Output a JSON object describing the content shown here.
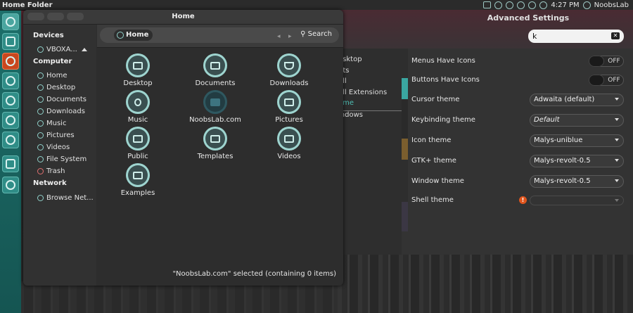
{
  "panel": {
    "title": "Home Folder",
    "time": "4:27 PM",
    "user": "NoobsLab"
  },
  "launcher": {
    "icons": [
      "ubuntu-icon",
      "files-icon",
      "firefox-icon",
      "app-icon",
      "app-icon",
      "app-icon",
      "app-icon",
      "app-icon",
      "app-icon"
    ]
  },
  "advanced": {
    "title": "Advanced Settings",
    "search_value": "k",
    "categories": [
      "Desktop",
      "Fonts",
      "Shell",
      "Shell Extensions",
      "Theme",
      "Windows"
    ],
    "categories_visible": [
      "esktop",
      "nts",
      "ell",
      "ell Extensions",
      "eme",
      "indows"
    ],
    "rows": [
      {
        "label": "Menus Have Icons",
        "type": "toggle",
        "value": "OFF"
      },
      {
        "label": "Buttons Have Icons",
        "type": "toggle",
        "value": "OFF"
      },
      {
        "label": "Cursor theme",
        "type": "combo",
        "value": "Adwaita (default)"
      },
      {
        "label": "Keybinding theme",
        "type": "combo",
        "value": "Default"
      },
      {
        "label": "Icon theme",
        "type": "combo",
        "value": "Malys-uniblue"
      },
      {
        "label": "GTK+ theme",
        "type": "combo",
        "value": "Malys-revolt-0.5"
      },
      {
        "label": "Window theme",
        "type": "combo",
        "value": "Malys-revolt-0.5"
      },
      {
        "label": "Shell theme",
        "type": "combo",
        "value": ""
      }
    ]
  },
  "home": {
    "title": "Home",
    "crumb": "Home",
    "search_label": "Search",
    "sidebar": {
      "devices_header": "Devices",
      "devices": [
        {
          "label": "VBOXA..."
        }
      ],
      "computer_header": "Computer",
      "computer": [
        {
          "label": "Home"
        },
        {
          "label": "Desktop"
        },
        {
          "label": "Documents"
        },
        {
          "label": "Downloads"
        },
        {
          "label": "Music"
        },
        {
          "label": "Pictures"
        },
        {
          "label": "Videos"
        },
        {
          "label": "File System"
        },
        {
          "label": "Trash"
        }
      ],
      "network_header": "Network",
      "network": [
        {
          "label": "Browse Net..."
        }
      ]
    },
    "items": [
      {
        "label": "Desktop"
      },
      {
        "label": "Documents"
      },
      {
        "label": "Downloads"
      },
      {
        "label": "Music"
      },
      {
        "label": "NoobsLab.com"
      },
      {
        "label": "Pictures"
      },
      {
        "label": "Public"
      },
      {
        "label": "Templates"
      },
      {
        "label": "Videos"
      },
      {
        "label": "Examples"
      }
    ],
    "status": "\"NoobsLab.com\" selected (containing 0 items)"
  }
}
